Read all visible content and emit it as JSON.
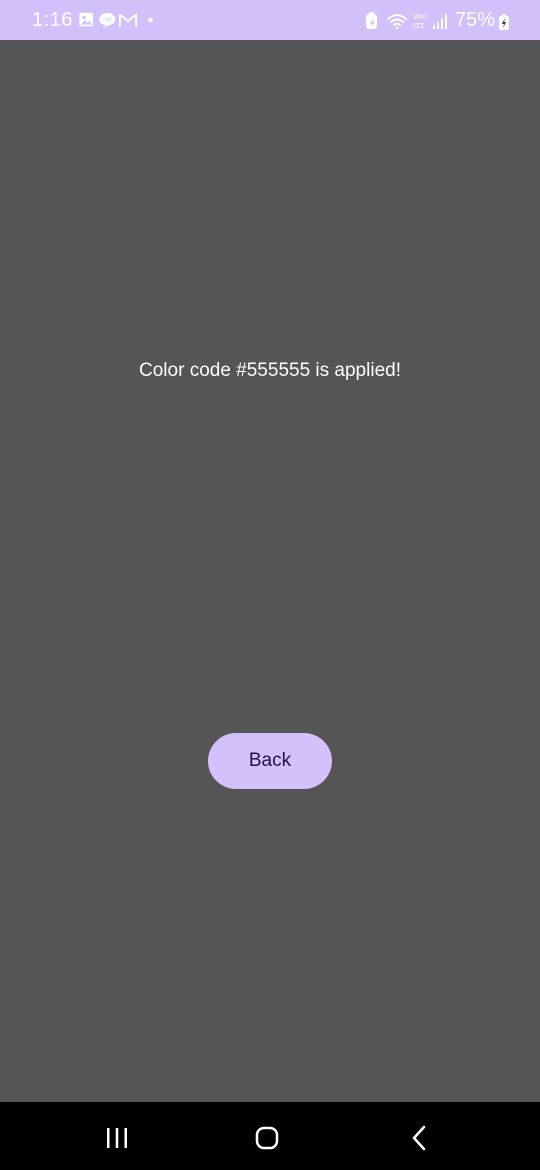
{
  "status_bar": {
    "time": "1:16",
    "battery_percent": "75%",
    "background_color": "#d1c0fa",
    "left_icons": [
      "gallery-icon",
      "line-chat-icon",
      "gmail-icon",
      "notification-dot-icon"
    ],
    "right_icons": [
      "battery-saver-icon",
      "wifi-icon",
      "volte-lte-icon",
      "signal-icon",
      "battery-charging-icon"
    ],
    "volte_label": "Vo)) LTE"
  },
  "main": {
    "background_color": "#555555",
    "message": "Color code #555555 is applied!",
    "back_button_label": "Back",
    "button_color": "#d4c1fc"
  },
  "nav_bar": {
    "buttons": [
      "recent-apps-icon",
      "home-icon",
      "back-icon"
    ]
  }
}
